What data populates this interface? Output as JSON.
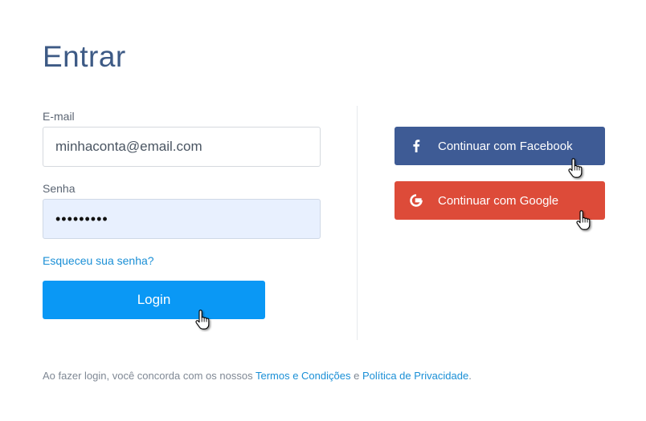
{
  "page": {
    "title": "Entrar"
  },
  "form": {
    "email_label": "E-mail",
    "email_value": "minhaconta@email.com",
    "password_label": "Senha",
    "password_value": "•••••••••",
    "forgot_link": "Esqueceu sua senha?",
    "login_button": "Login"
  },
  "social": {
    "facebook_label": "Continuar com Facebook",
    "google_label": "Continuar com Google",
    "facebook_icon": "facebook-icon",
    "google_icon": "google-icon"
  },
  "legal": {
    "prefix": "Ao fazer login, você concorda com os nossos ",
    "terms_link": "Termos e Condições",
    "conjunction": " e ",
    "privacy_link": "Política de Privacidade",
    "suffix": "."
  },
  "colors": {
    "title": "#3d5a85",
    "login_button": "#0a98f5",
    "facebook_button": "#3e5b95",
    "google_button": "#dd4b39",
    "link": "#1a8fd6",
    "password_fill": "#e8f0fe"
  }
}
